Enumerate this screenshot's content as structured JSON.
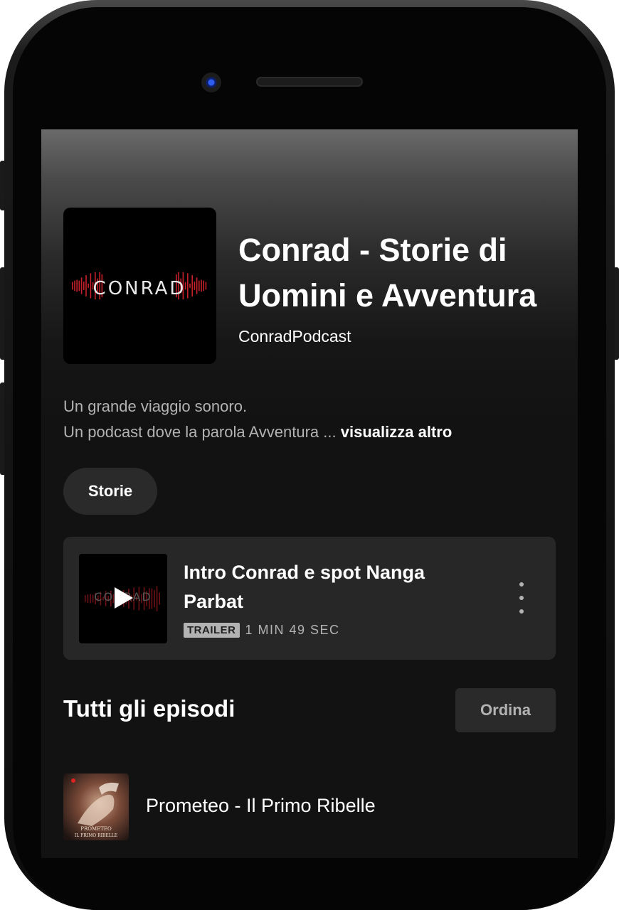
{
  "podcast": {
    "cover_logo_text": "CONRAD",
    "title": "Conrad - Storie di Uomini e Avventura",
    "publisher": "ConradPodcast",
    "description_line1": "Un grande viaggio sonoro.",
    "description_line2": "Un podcast dove la parola Avventura ...",
    "see_more": "visualizza altro"
  },
  "category_chip": {
    "label": "Storie"
  },
  "trailer": {
    "title": "Intro Conrad e spot Nanga Parbat",
    "badge": "TRAILER",
    "duration": "1 MIN 49 SEC"
  },
  "episodes_section": {
    "title": "Tutti gli episodi",
    "sort_label": "Ordina",
    "items": [
      {
        "title": "Prometeo - Il Primo Ribelle",
        "thumb_text_1": "PROMETEO",
        "thumb_text_2": "IL PRIMO RIBELLE"
      }
    ]
  },
  "colors": {
    "background": "#121212",
    "card": "#272727",
    "text_primary": "#ffffff",
    "text_secondary": "#b3b3b3",
    "logo_wave": "#c8202b"
  }
}
